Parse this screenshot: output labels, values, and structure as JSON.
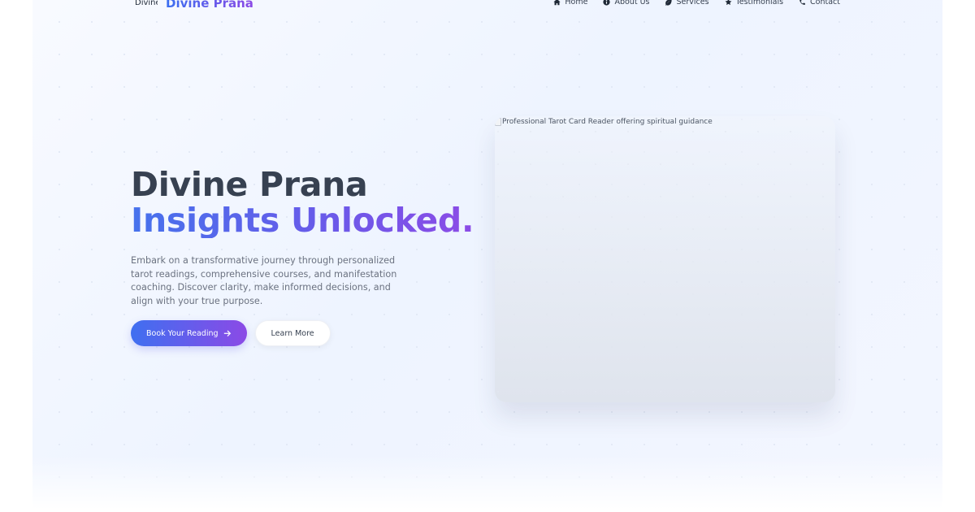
{
  "brand": {
    "logo_alt": "Divine Prana Logo",
    "name": "Divine Prana"
  },
  "nav": {
    "items": [
      {
        "label": "Home",
        "icon": "home-icon"
      },
      {
        "label": "About Us",
        "icon": "info-circle-icon"
      },
      {
        "label": "Services",
        "icon": "leaf-icon"
      },
      {
        "label": "Testimonials",
        "icon": "star-icon"
      },
      {
        "label": "Contact",
        "icon": "phone-icon"
      }
    ]
  },
  "hero": {
    "title_line1": "Divine Prana",
    "title_line2": "Insights Unlocked.",
    "description": "Embark on a transformative journey through personalized tarot readings, comprehensive courses, and manifestation coaching. Discover clarity, make informed decisions, and align with your true purpose.",
    "primary_button": "Book Your Reading",
    "primary_button_icon": "arrow-right-icon",
    "secondary_button": "Learn More",
    "image_alt": "Professional Tarot Card Reader offering spiritual guidance"
  },
  "colors": {
    "accent_start": "#3f6ff0",
    "accent_end": "#8b4ae6",
    "heading": "#374151",
    "body_text": "#6b7280"
  }
}
